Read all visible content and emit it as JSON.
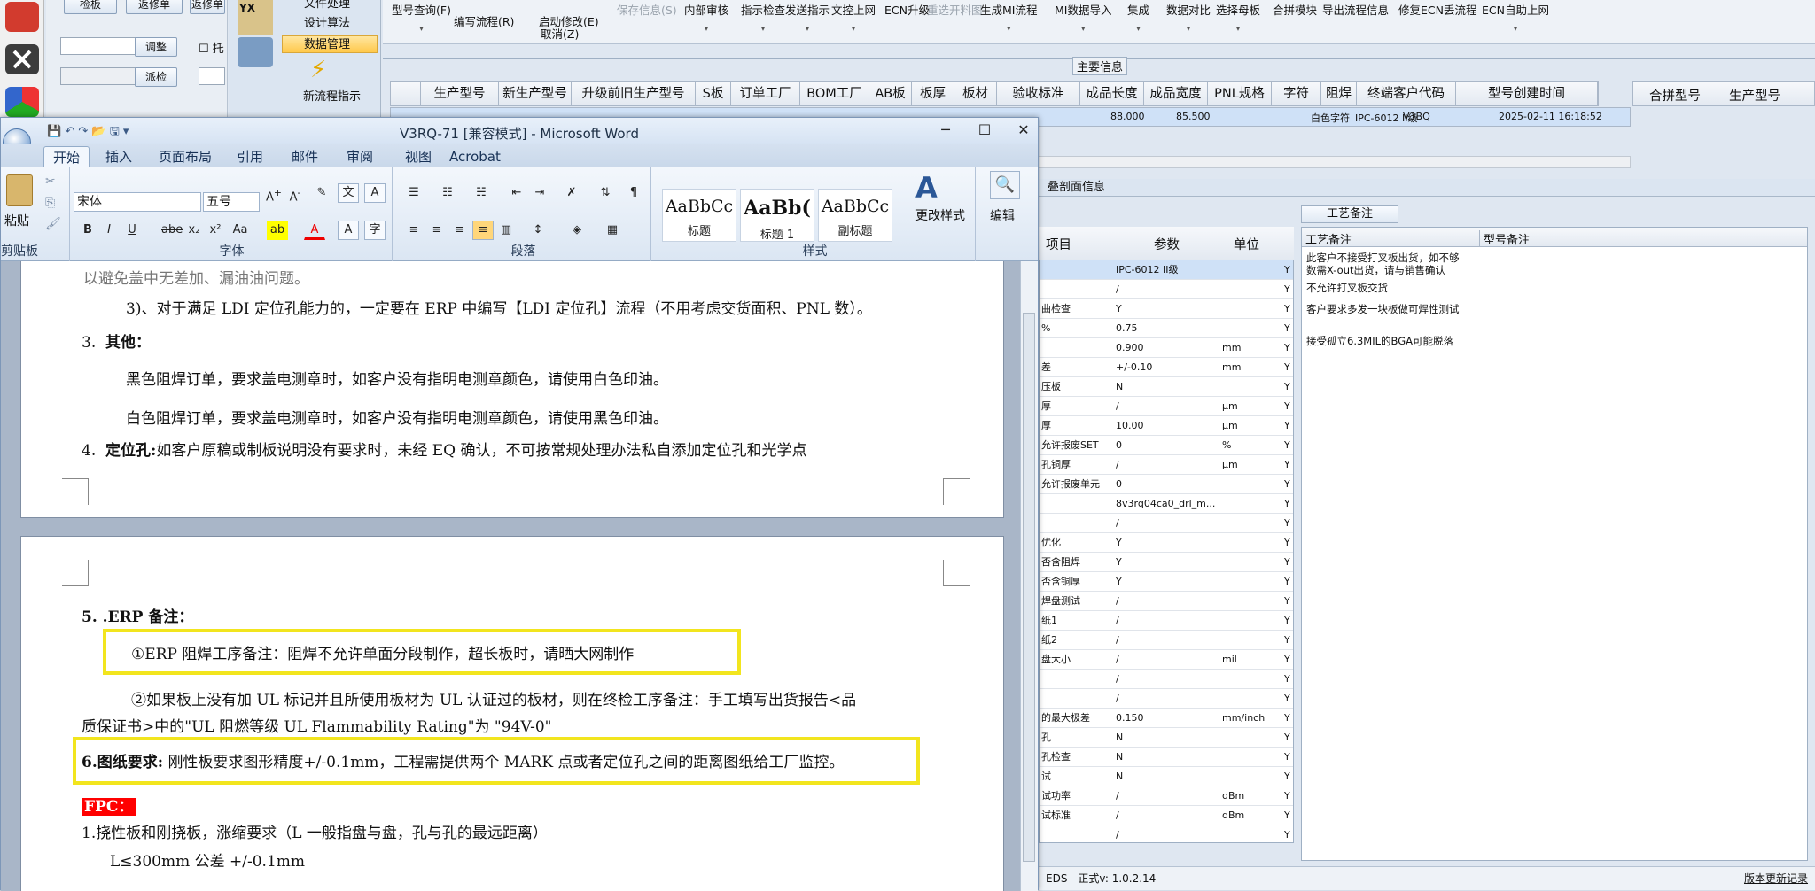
{
  "erp": {
    "left_buttons": {
      "check_board": "检板",
      "rework": "返修单",
      "adjust": "调整",
      "dispatch": "派检",
      "tuo": "托"
    },
    "nav": {
      "file_process": "文件处理",
      "design_algo": "设计算法",
      "data_mgmt": "数据管理",
      "new_flow": "新流程指示",
      "yx": "YX"
    },
    "top_ribbon": [
      {
        "label": "型号查询(F)",
        "arrow": "▾"
      },
      {
        "label": "编写流程(R)",
        "arrow": ""
      },
      {
        "label": "启动修改(E)",
        "arrow": ""
      },
      {
        "label": "保存信息(S)",
        "arrow": "",
        "disabled": true
      },
      {
        "label": "内部审核",
        "arrow": "▾"
      },
      {
        "label": "指示检查",
        "arrow": "▾"
      },
      {
        "label": "发送指示",
        "arrow": "▾"
      },
      {
        "label": "文控上网",
        "arrow": "▾"
      },
      {
        "label": "ECN升级",
        "arrow": ""
      },
      {
        "label": "重选开料图",
        "arrow": "",
        "disabled": true
      },
      {
        "label": "生成MI流程",
        "arrow": "▾"
      },
      {
        "label": "MI数据导入",
        "arrow": "▾"
      },
      {
        "label": "集成",
        "arrow": "▾"
      },
      {
        "label": "数据对比",
        "arrow": "▾"
      },
      {
        "label": "选择母板",
        "arrow": "▾"
      },
      {
        "label": "合拼模块",
        "arrow": ""
      },
      {
        "label": "导出流程信息",
        "arrow": ""
      },
      {
        "label": "修复ECN丢流程",
        "arrow": ""
      },
      {
        "label": "ECN自助上网",
        "arrow": "▾"
      }
    ],
    "cancel_label": "取消(Z)",
    "main_info_label": "主要信息",
    "grid_columns": [
      "生产型号",
      "新生产型号",
      "升级前旧生产型号",
      "S板",
      "订单工厂",
      "BOM工厂",
      "AB板",
      "板厚",
      "板材",
      "验收标准",
      "成品长度",
      "成品宽度",
      "PNL规格",
      "字符",
      "阻焊",
      "终端客户代码",
      "型号创建时间"
    ],
    "right_columns": [
      "合拼型号",
      "生产型号"
    ],
    "grid_row": {
      "std": "IPC-6012 II级",
      "len": "88.000",
      "wid": "85.500",
      "char": "白色字符",
      "cust": "V3BQ",
      "time": "2025-02-11 16:18:52"
    },
    "panel_title": "叠剖面信息",
    "param_headers": {
      "item": "项目",
      "param": "参数",
      "unit": "单位"
    },
    "param_rows": [
      {
        "item": "",
        "param": "IPC-6012 II级",
        "unit": ""
      },
      {
        "item": "",
        "param": "/",
        "unit": ""
      },
      {
        "item": "曲检查",
        "param": "Y",
        "unit": ""
      },
      {
        "item": "%",
        "param": "0.75",
        "unit": ""
      },
      {
        "item": "",
        "param": "0.900",
        "unit": "mm"
      },
      {
        "item": "差",
        "param": "+/-0.10",
        "unit": "mm"
      },
      {
        "item": "压板",
        "param": "N",
        "unit": ""
      },
      {
        "item": "厚",
        "param": "/",
        "unit": "μm"
      },
      {
        "item": "厚",
        "param": "10.00",
        "unit": "μm"
      },
      {
        "item": "允许报废SET",
        "param": "0",
        "unit": "%"
      },
      {
        "item": "孔铜厚",
        "param": "/",
        "unit": "μm"
      },
      {
        "item": "允许报废单元",
        "param": "0",
        "unit": ""
      },
      {
        "item": "",
        "param": "8v3rq04ca0_drl_m...",
        "unit": ""
      },
      {
        "item": "",
        "param": "/",
        "unit": ""
      },
      {
        "item": "优化",
        "param": "Y",
        "unit": ""
      },
      {
        "item": "否含阻焊",
        "param": "Y",
        "unit": ""
      },
      {
        "item": "否含铜厚",
        "param": "Y",
        "unit": ""
      },
      {
        "item": "焊盘测试",
        "param": "/",
        "unit": ""
      },
      {
        "item": "纸1",
        "param": "/",
        "unit": ""
      },
      {
        "item": "纸2",
        "param": "/",
        "unit": ""
      },
      {
        "item": "盘大小",
        "param": "/",
        "unit": "mil"
      },
      {
        "item": "",
        "param": "/",
        "unit": ""
      },
      {
        "item": "",
        "param": "/",
        "unit": ""
      },
      {
        "item": "的最大极差",
        "param": "0.150",
        "unit": "mm/inch"
      },
      {
        "item": "孔",
        "param": "N",
        "unit": ""
      },
      {
        "item": "孔检查",
        "param": "N",
        "unit": ""
      },
      {
        "item": "试",
        "param": "N",
        "unit": ""
      },
      {
        "item": "试功率",
        "param": "/",
        "unit": "dBm"
      },
      {
        "item": "试标准",
        "param": "/",
        "unit": "dBm"
      },
      {
        "item": "",
        "param": "/",
        "unit": ""
      }
    ],
    "process_tab": "工艺备注",
    "process_headers": {
      "left": "工艺备注",
      "right": "型号备注"
    },
    "process_notes": [
      "此客户不接受打叉板出货，如不够数需X-out出货，请与销售确认",
      "不允许打叉板交货",
      "客户要求多发一块板做可焊性测试",
      "接受孤立6.3MIL的BGA可能脱落"
    ],
    "status_left": "EDS - 正式v: 1.0.2.14",
    "status_right": "版本更新记录"
  },
  "word": {
    "title": "V3RQ-71 [兼容模式] - Microsoft Word",
    "tabs": [
      "开始",
      "插入",
      "页面布局",
      "引用",
      "邮件",
      "审阅",
      "视图",
      "Acrobat"
    ],
    "font_name": "宋体",
    "font_size": "五号",
    "groups": {
      "clipboard": "剪贴板",
      "font": "字体",
      "paragraph": "段落",
      "styles": "样式"
    },
    "paste_label": "粘贴",
    "styles": [
      {
        "sample": "AaBbCc",
        "name": "标题"
      },
      {
        "sample": "AaBb(",
        "name": "标题 1"
      },
      {
        "sample": "AaBbCc",
        "name": "副标题"
      }
    ],
    "change_style": "更改样式",
    "edit": "编辑",
    "doc": {
      "l0": "以避免盖中无差加、漏油油问题。",
      "l1": "3)、对于满足 LDI 定位孔能力的，一定要在 ERP 中编写【LDI 定位孔】流程（不用考虑交货面积、PNL 数）。",
      "l2_num": "3.",
      "l2": "其他：",
      "l3": "黑色阻焊订单，要求盖电测章时，如客户没有指明电测章颜色，请使用白色印油。",
      "l4": "白色阻焊订单，要求盖电测章时，如客户没有指明电测章颜色，请使用黑色印油。",
      "l5_num": "4.",
      "l5_bold": "定位孔:",
      "l5": "如客户原稿或制板说明没有要求时，未经 EQ 确认，不可按常规处理办法私自添加定位孔和光学点",
      "p2_l1": "5. .ERP 备注：",
      "p2_l2": "①ERP 阻焊工序备注：阻焊不允许单面分段制作，超长板时，请晒大网制作",
      "p2_l3": "②如果板上没有加 UL 标记并且所使用板材为 UL 认证过的板材，则在终检工序备注：手工填写出货报告<品",
      "p2_l4": "质保证书>中的\"UL 阻燃等级 UL Flammability Rating\"为 \"94V-0\"",
      "p2_l5_bold": "6.图纸要求:",
      "p2_l5": "刚性板要求图形精度+/-0.1mm，工程需提供两个 MARK 点或者定位孔之间的距离图纸给工厂监控。",
      "fpc": "FPC：",
      "p2_l7": "1.挠性板和刚挠板，涨缩要求（L 一般指盘与盘，孔与孔的最远距离）",
      "p2_l8": "L≤300mm 公差 +/-0.1mm"
    }
  }
}
